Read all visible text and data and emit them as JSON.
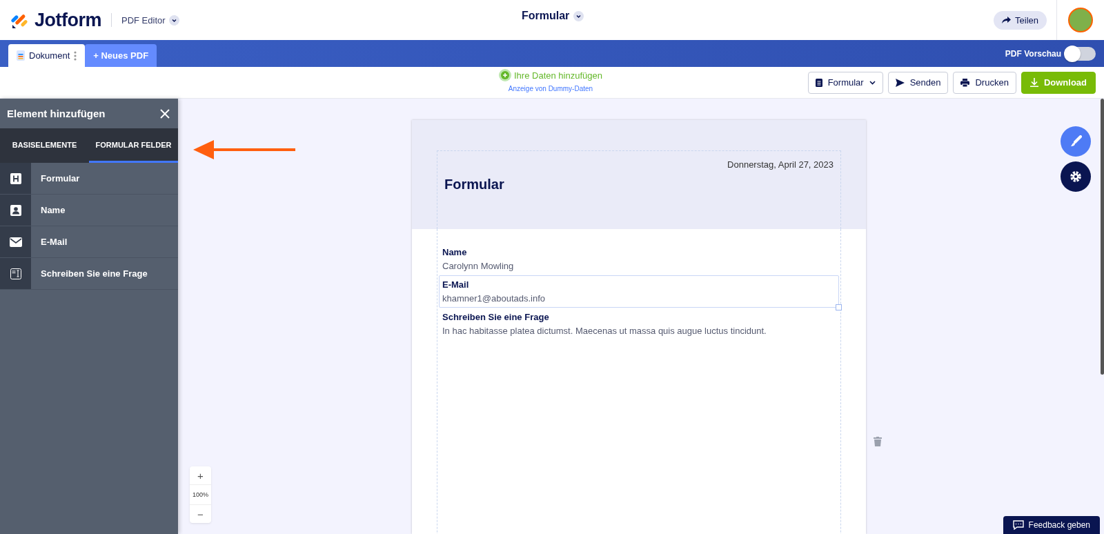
{
  "header": {
    "logo": "Jotform",
    "product": "PDF Editor",
    "title": "Formular",
    "share": "Teilen"
  },
  "doc_tabs": [
    {
      "label": "Dokument",
      "selected": true
    },
    {
      "label": "+ Neues PDF",
      "selected": false
    }
  ],
  "preview_toggle": {
    "label": "PDF Vorschau",
    "on": false
  },
  "toolbar": {
    "add_data": "Ihre Daten hinzufügen",
    "dummy_note": "Anzeige von Dummy-Daten",
    "buttons": [
      {
        "kind": "dropdown",
        "label": "Formular"
      },
      {
        "kind": "send",
        "label": "Senden"
      },
      {
        "kind": "print",
        "label": "Drucken"
      },
      {
        "kind": "download",
        "label": "Download"
      }
    ]
  },
  "sidebar": {
    "title": "Element hinzufügen",
    "tabs": [
      {
        "label": "BASISELEMENTE",
        "selected": false
      },
      {
        "label": "FORMULAR FELDER",
        "selected": true
      }
    ],
    "items": [
      {
        "kind": "heading",
        "label": "Formular"
      },
      {
        "kind": "name",
        "label": "Name"
      },
      {
        "kind": "email",
        "label": "E-Mail"
      },
      {
        "kind": "question",
        "label": "Schreiben Sie eine Frage"
      }
    ]
  },
  "document": {
    "date": "Donnerstag, April 27, 2023",
    "title": "Formular",
    "fields": [
      {
        "label": "Name",
        "value": "Carolynn Mowling",
        "selected": false
      },
      {
        "label": "E-Mail",
        "value": "khamner1@aboutads.info",
        "selected": true
      },
      {
        "label": "Schreiben Sie eine Frage",
        "value": "In hac habitasse platea dictumst. Maecenas ut massa quis augue luctus tincidunt.",
        "selected": false
      }
    ]
  },
  "zoom": {
    "plus": "+",
    "level": "100%",
    "minus": "−"
  },
  "feedback": "Feedback geben"
}
